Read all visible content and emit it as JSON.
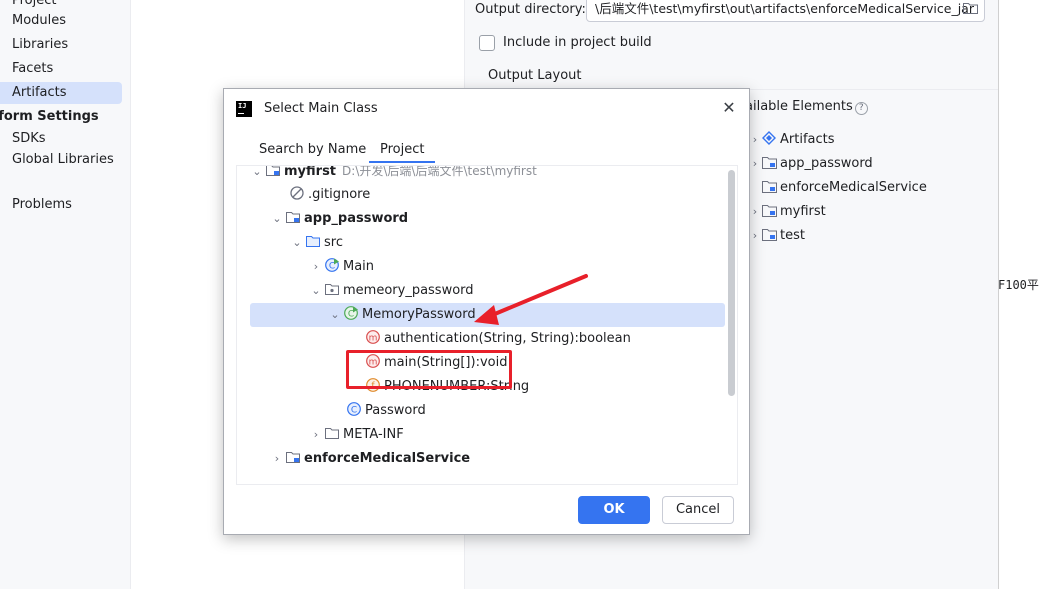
{
  "sidebar": {
    "items": [
      {
        "label": "Project",
        "selected": false
      },
      {
        "label": "Modules",
        "selected": false
      },
      {
        "label": "Libraries",
        "selected": false
      },
      {
        "label": "Facets",
        "selected": false
      },
      {
        "label": "Artifacts",
        "selected": true
      }
    ],
    "platform_header": "tform Settings",
    "platform_items": [
      {
        "label": "SDKs"
      },
      {
        "label": "Global Libraries"
      }
    ],
    "problems": "Problems"
  },
  "artifact": {
    "output_directory_label": "Output directory:",
    "output_directory_value": "\\后端文件\\test\\myfirst\\out\\artifacts\\enforceMedicalService_jar",
    "include_build_label": "Include in project build",
    "output_layout_label": "Output Layout",
    "available_elements_label": "ailable Elements",
    "available_items": [
      {
        "label": "Artifacts",
        "icon": "artifacts-icon",
        "chevron": true
      },
      {
        "label": "app_password",
        "icon": "module-folder-icon",
        "chevron": true
      },
      {
        "label": "enforceMedicalService",
        "icon": "module-folder-icon",
        "chevron": false
      },
      {
        "label": "myfirst",
        "icon": "module-folder-icon",
        "chevron": true
      },
      {
        "label": "test",
        "icon": "module-folder-icon",
        "chevron": true
      }
    ],
    "cut_text": "F100平"
  },
  "dialog": {
    "title": "Select Main Class",
    "tabs": [
      {
        "label": "Search by Name",
        "active": false
      },
      {
        "label": "Project",
        "active": true
      }
    ],
    "tree": {
      "root_name": "myfirst",
      "root_path": "D:\\开发\\后端\\后端文件\\test\\myfirst",
      "gitignore": ".gitignore",
      "app_password": "app_password",
      "src": "src",
      "main": "Main",
      "package": "memeory_password",
      "memory_password": "MemoryPassword",
      "auth_method": "authentication(String, String):boolean",
      "main_method": "main(String[]):void",
      "phone_field": "PHONENUMBER:String",
      "password_class": "Password",
      "meta_inf": "META-INF",
      "enforce": "enforceMedicalService"
    },
    "ok_label": "OK",
    "cancel_label": "Cancel"
  },
  "colors": {
    "accent": "#3574f0",
    "selection": "#d5e1fb",
    "annotation_red": "#e8202a"
  }
}
